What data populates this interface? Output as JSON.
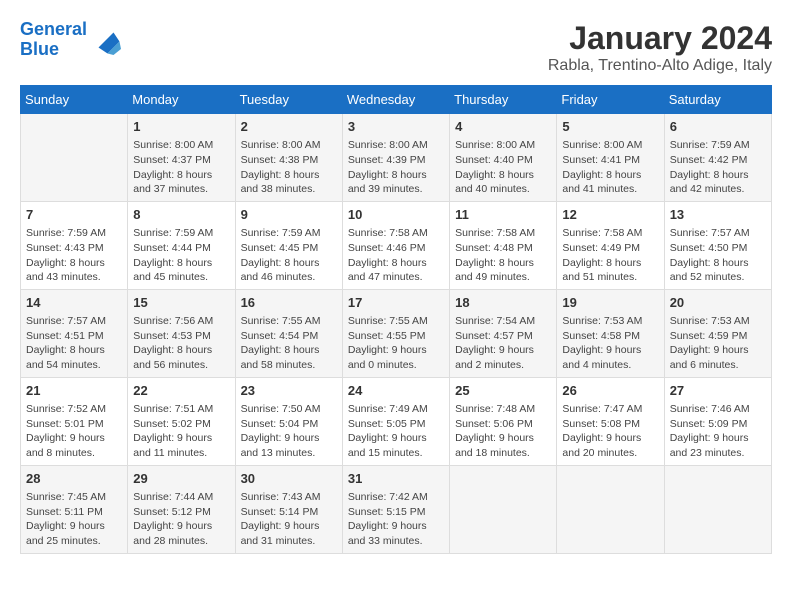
{
  "logo": {
    "line1": "General",
    "line2": "Blue"
  },
  "title": "January 2024",
  "location": "Rabla, Trentino-Alto Adige, Italy",
  "days_of_week": [
    "Sunday",
    "Monday",
    "Tuesday",
    "Wednesday",
    "Thursday",
    "Friday",
    "Saturday"
  ],
  "weeks": [
    [
      {
        "day": "",
        "info": ""
      },
      {
        "day": "1",
        "info": "Sunrise: 8:00 AM\nSunset: 4:37 PM\nDaylight: 8 hours\nand 37 minutes."
      },
      {
        "day": "2",
        "info": "Sunrise: 8:00 AM\nSunset: 4:38 PM\nDaylight: 8 hours\nand 38 minutes."
      },
      {
        "day": "3",
        "info": "Sunrise: 8:00 AM\nSunset: 4:39 PM\nDaylight: 8 hours\nand 39 minutes."
      },
      {
        "day": "4",
        "info": "Sunrise: 8:00 AM\nSunset: 4:40 PM\nDaylight: 8 hours\nand 40 minutes."
      },
      {
        "day": "5",
        "info": "Sunrise: 8:00 AM\nSunset: 4:41 PM\nDaylight: 8 hours\nand 41 minutes."
      },
      {
        "day": "6",
        "info": "Sunrise: 7:59 AM\nSunset: 4:42 PM\nDaylight: 8 hours\nand 42 minutes."
      }
    ],
    [
      {
        "day": "7",
        "info": "Sunrise: 7:59 AM\nSunset: 4:43 PM\nDaylight: 8 hours\nand 43 minutes."
      },
      {
        "day": "8",
        "info": "Sunrise: 7:59 AM\nSunset: 4:44 PM\nDaylight: 8 hours\nand 45 minutes."
      },
      {
        "day": "9",
        "info": "Sunrise: 7:59 AM\nSunset: 4:45 PM\nDaylight: 8 hours\nand 46 minutes."
      },
      {
        "day": "10",
        "info": "Sunrise: 7:58 AM\nSunset: 4:46 PM\nDaylight: 8 hours\nand 47 minutes."
      },
      {
        "day": "11",
        "info": "Sunrise: 7:58 AM\nSunset: 4:48 PM\nDaylight: 8 hours\nand 49 minutes."
      },
      {
        "day": "12",
        "info": "Sunrise: 7:58 AM\nSunset: 4:49 PM\nDaylight: 8 hours\nand 51 minutes."
      },
      {
        "day": "13",
        "info": "Sunrise: 7:57 AM\nSunset: 4:50 PM\nDaylight: 8 hours\nand 52 minutes."
      }
    ],
    [
      {
        "day": "14",
        "info": "Sunrise: 7:57 AM\nSunset: 4:51 PM\nDaylight: 8 hours\nand 54 minutes."
      },
      {
        "day": "15",
        "info": "Sunrise: 7:56 AM\nSunset: 4:53 PM\nDaylight: 8 hours\nand 56 minutes."
      },
      {
        "day": "16",
        "info": "Sunrise: 7:55 AM\nSunset: 4:54 PM\nDaylight: 8 hours\nand 58 minutes."
      },
      {
        "day": "17",
        "info": "Sunrise: 7:55 AM\nSunset: 4:55 PM\nDaylight: 9 hours\nand 0 minutes."
      },
      {
        "day": "18",
        "info": "Sunrise: 7:54 AM\nSunset: 4:57 PM\nDaylight: 9 hours\nand 2 minutes."
      },
      {
        "day": "19",
        "info": "Sunrise: 7:53 AM\nSunset: 4:58 PM\nDaylight: 9 hours\nand 4 minutes."
      },
      {
        "day": "20",
        "info": "Sunrise: 7:53 AM\nSunset: 4:59 PM\nDaylight: 9 hours\nand 6 minutes."
      }
    ],
    [
      {
        "day": "21",
        "info": "Sunrise: 7:52 AM\nSunset: 5:01 PM\nDaylight: 9 hours\nand 8 minutes."
      },
      {
        "day": "22",
        "info": "Sunrise: 7:51 AM\nSunset: 5:02 PM\nDaylight: 9 hours\nand 11 minutes."
      },
      {
        "day": "23",
        "info": "Sunrise: 7:50 AM\nSunset: 5:04 PM\nDaylight: 9 hours\nand 13 minutes."
      },
      {
        "day": "24",
        "info": "Sunrise: 7:49 AM\nSunset: 5:05 PM\nDaylight: 9 hours\nand 15 minutes."
      },
      {
        "day": "25",
        "info": "Sunrise: 7:48 AM\nSunset: 5:06 PM\nDaylight: 9 hours\nand 18 minutes."
      },
      {
        "day": "26",
        "info": "Sunrise: 7:47 AM\nSunset: 5:08 PM\nDaylight: 9 hours\nand 20 minutes."
      },
      {
        "day": "27",
        "info": "Sunrise: 7:46 AM\nSunset: 5:09 PM\nDaylight: 9 hours\nand 23 minutes."
      }
    ],
    [
      {
        "day": "28",
        "info": "Sunrise: 7:45 AM\nSunset: 5:11 PM\nDaylight: 9 hours\nand 25 minutes."
      },
      {
        "day": "29",
        "info": "Sunrise: 7:44 AM\nSunset: 5:12 PM\nDaylight: 9 hours\nand 28 minutes."
      },
      {
        "day": "30",
        "info": "Sunrise: 7:43 AM\nSunset: 5:14 PM\nDaylight: 9 hours\nand 31 minutes."
      },
      {
        "day": "31",
        "info": "Sunrise: 7:42 AM\nSunset: 5:15 PM\nDaylight: 9 hours\nand 33 minutes."
      },
      {
        "day": "",
        "info": ""
      },
      {
        "day": "",
        "info": ""
      },
      {
        "day": "",
        "info": ""
      }
    ]
  ]
}
